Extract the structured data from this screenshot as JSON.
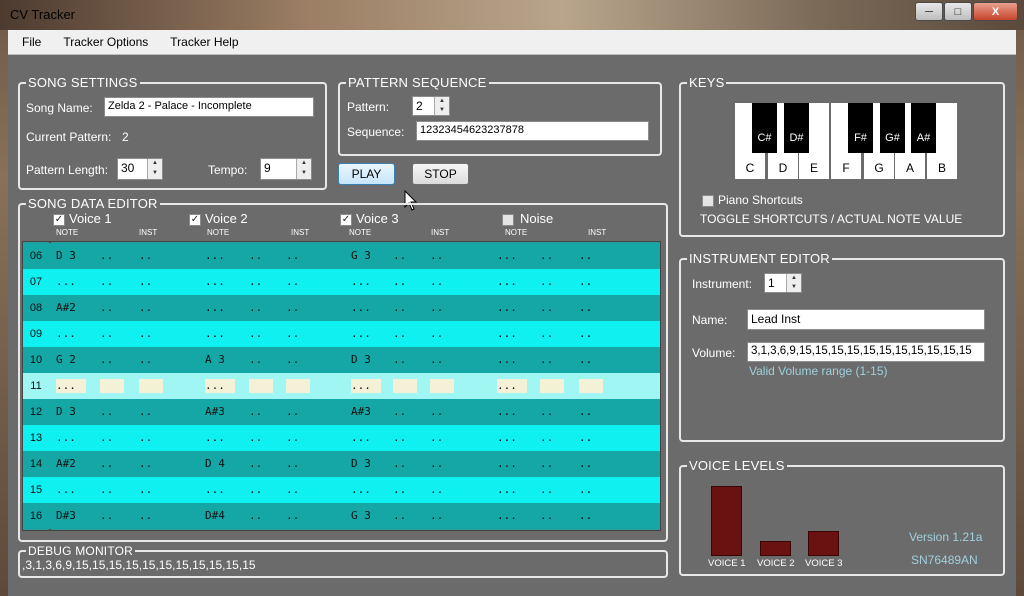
{
  "window": {
    "title": "CV Tracker",
    "min_label": "─",
    "max_label": "□",
    "close_label": "X"
  },
  "menu": [
    {
      "label": "File"
    },
    {
      "label": "Tracker Options"
    },
    {
      "label": "Tracker Help"
    }
  ],
  "song_settings": {
    "title": "SONG SETTINGS",
    "song_name_label": "Song Name:",
    "song_name": "Zelda 2 - Palace - Incomplete",
    "current_pattern_label": "Current Pattern:",
    "current_pattern": "2",
    "pattern_length_label": "Pattern Length:",
    "pattern_length": "30",
    "tempo_label": "Tempo:",
    "tempo": "9"
  },
  "pattern_sequence": {
    "title": "PATTERN SEQUENCE",
    "pattern_label": "Pattern:",
    "pattern": "2",
    "sequence_label": "Sequence:",
    "sequence": "12323454623237878"
  },
  "transport": {
    "play": "PLAY",
    "stop": "STOP"
  },
  "song_data_editor": {
    "title": "SONG DATA EDITOR",
    "voices": [
      {
        "label": "Voice 1",
        "checked": true
      },
      {
        "label": "Voice 2",
        "checked": true
      },
      {
        "label": "Voice 3",
        "checked": true
      },
      {
        "label": "Noise",
        "checked": false
      }
    ],
    "note_header": "NOTE",
    "inst_header": "INST",
    "current_row": "11",
    "rows": [
      {
        "num": "06",
        "cells": [
          "D 3",
          "..",
          "..",
          "...",
          "..",
          "..",
          "G 3",
          "..",
          "..",
          "...",
          "..",
          ".."
        ]
      },
      {
        "num": "07",
        "cells": [
          "...",
          "..",
          "..",
          "...",
          "..",
          "..",
          "...",
          "..",
          "..",
          "...",
          "..",
          ".."
        ]
      },
      {
        "num": "08",
        "cells": [
          "A#2",
          "..",
          "..",
          "...",
          "..",
          "..",
          "...",
          "..",
          "..",
          "...",
          "..",
          ".."
        ]
      },
      {
        "num": "09",
        "cells": [
          "...",
          "..",
          "..",
          "...",
          "..",
          "..",
          "...",
          "..",
          "..",
          "...",
          "..",
          ".."
        ]
      },
      {
        "num": "10",
        "cells": [
          "G 2",
          "..",
          "..",
          "A 3",
          "..",
          "..",
          "D 3",
          "..",
          "..",
          "...",
          "..",
          ".."
        ]
      },
      {
        "num": "11",
        "cells": [
          "...",
          "",
          "",
          "...",
          "",
          "",
          "...",
          "",
          "",
          "...",
          "",
          ""
        ]
      },
      {
        "num": "12",
        "cells": [
          "D 3",
          "..",
          "..",
          "A#3",
          "..",
          "..",
          "A#3",
          "..",
          "..",
          "...",
          "..",
          ".."
        ]
      },
      {
        "num": "13",
        "cells": [
          "...",
          "..",
          "..",
          "...",
          "..",
          "..",
          "...",
          "..",
          "..",
          "...",
          "..",
          ".."
        ]
      },
      {
        "num": "14",
        "cells": [
          "A#2",
          "..",
          "..",
          "D 4",
          "..",
          "..",
          "D 3",
          "..",
          "..",
          "...",
          "..",
          ".."
        ]
      },
      {
        "num": "15",
        "cells": [
          "...",
          "..",
          "..",
          "...",
          "..",
          "..",
          "...",
          "..",
          "..",
          "...",
          "..",
          ".."
        ]
      },
      {
        "num": "16",
        "cells": [
          "D#3",
          "..",
          "..",
          "D#4",
          "..",
          "..",
          "G 3",
          "..",
          "..",
          "...",
          "..",
          ".."
        ]
      }
    ],
    "row_colors": {
      "dark": "#15a6a6",
      "light": "#0ff0f0",
      "current": "#9ff6f2"
    }
  },
  "debug_monitor": {
    "title": "DEBUG MONITOR",
    "text": ",3,1,3,6,9,15,15,15,15,15,15,15,15,15,15,15"
  },
  "keys": {
    "title": "KEYS",
    "white": [
      "C",
      "D",
      "E",
      "F",
      "G",
      "A",
      "B"
    ],
    "black": [
      "C#",
      "D#",
      "F#",
      "G#",
      "A#"
    ],
    "piano_shortcuts_label": "Piano Shortcuts",
    "piano_shortcuts_checked": false,
    "toggle_text": "TOGGLE SHORTCUTS / ACTUAL NOTE VALUE"
  },
  "instrument_editor": {
    "title": "INSTRUMENT EDITOR",
    "instrument_label": "Instrument:",
    "instrument": "1",
    "name_label": "Name:",
    "name": "Lead Inst",
    "volume_label": "Volume:",
    "volume": "3,1,3,6,9,15,15,15,15,15,15,15,15,15,15,15",
    "volume_hint": "Valid Volume range (1-15)"
  },
  "voice_levels": {
    "title": "VOICE LEVELS",
    "levels": [
      {
        "label": "VOICE 1",
        "level": 1.0
      },
      {
        "label": "VOICE 2",
        "level": 0.22
      },
      {
        "label": "VOICE 3",
        "level": 0.36
      }
    ],
    "version": "Version 1.21a",
    "chip": "SN76489AN",
    "bar_color": "#6a1212"
  }
}
